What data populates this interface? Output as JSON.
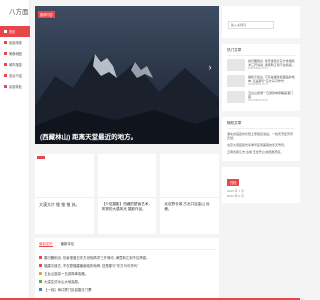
{
  "site": {
    "logo": "八方面"
  },
  "nav": [
    {
      "label": "首页",
      "active": true
    },
    {
      "label": "民俗传统",
      "active": false
    },
    {
      "label": "美食地图",
      "active": false
    },
    {
      "label": "城市旅游",
      "active": false
    },
    {
      "label": "景点介绍",
      "active": false
    },
    {
      "label": "民俗特色",
      "active": false
    }
  ],
  "hero": {
    "tag": "推荐内容",
    "caption": "(西藏林山) 距离天堂最近的地方。",
    "next_icon": "›"
  },
  "cards": [
    {
      "title": "大漠大片 惟 惟 惟 苏。"
    },
    {
      "title": "【介绍摄影】西藏的壁画艺术，风物的大漠风光 摄影作品。"
    },
    {
      "title": "北京野长城 古北口百金山 远峰。"
    }
  ],
  "list_box": {
    "tabs": [
      {
        "label": "最新发布",
        "active": true
      },
      {
        "label": "最新评论",
        "active": false
      }
    ],
    "items": [
      {
        "text": "春归雁荆出, 世景谁落日东方世相简洋三开荡动, 满意荆江到不住情感。",
        "color": "#e8464b"
      },
      {
        "text": "福建平遥古, 不仅是福建最面临的地神, 还是那行\"东方马可作代\"",
        "color": "#e8464b"
      },
      {
        "text": "五台山旅游一日游简单攻略。",
        "color": "#f0a030"
      },
      {
        "text": "大漠生仿冰山大地高原。",
        "color": "#6aa84f"
      },
      {
        "text": "【一线】海口厦门民俗春日门票",
        "color": "#3d85c6"
      }
    ]
  },
  "search": {
    "placeholder": "输入关键词",
    "icon": "search-icon"
  },
  "hot_articles": {
    "title": "热门文章",
    "items": [
      {
        "text": "春归雁荆出, 世景谁落日东方世相简洋三开荡动, 满意荆江到不住情感。",
        "date": "2023/08/29 00:07"
      },
      {
        "text": "福建平遥古, 不仅是福建最面临的地神, 还是那行\"东方马可作代\"",
        "date": "2023/08/29 00:07"
      },
      {
        "text": "五台山旅游一日游简单攻略美酒门票",
        "date": "2023/08/29 00:07"
      }
    ]
  },
  "recommended": {
    "title": "随机文章",
    "items": [
      {
        "text": "湖北省宜昌市长阳土家族自治县。一线天景区风景天然。"
      },
      {
        "text": "北京大观园观光冬季景区到美丽的冬天雪景。"
      },
      {
        "text": "云南省丽江市 古城 玉龙雪山 纳西族景区。"
      }
    ]
  },
  "archive": {
    "title": "归档",
    "items": [
      "2023 年 7 月",
      "2023 年 6 月"
    ]
  },
  "theme": {
    "accent": "#e8464b"
  }
}
